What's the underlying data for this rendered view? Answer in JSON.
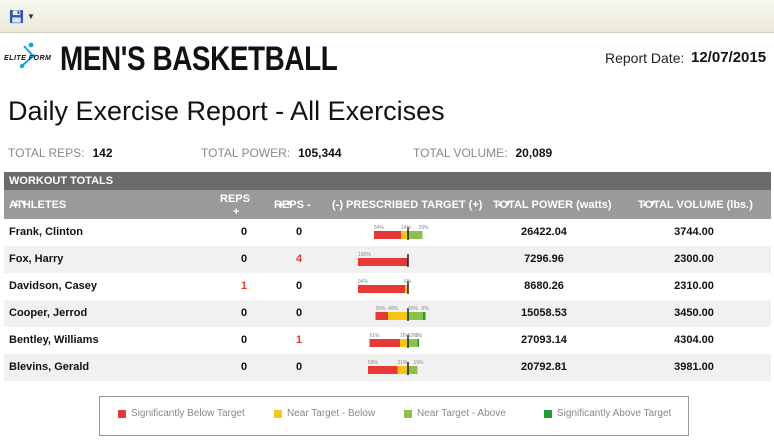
{
  "team_title": "MEN'S BASKETBALL",
  "logo": {
    "text": "ELITE FORM"
  },
  "report_date": {
    "label": "Report Date:",
    "value": "12/07/2015"
  },
  "report_title": "Daily Exercise Report - All Exercises",
  "totals": [
    {
      "label": "TOTAL REPS:",
      "value": "142"
    },
    {
      "label": "TOTAL POWER:",
      "value": "105,344"
    },
    {
      "label": "TOTAL VOLUME:",
      "value": "20,089"
    }
  ],
  "section_header": "WORKOUT TOTALS",
  "columns": {
    "athletes": "ATHLETES",
    "reps_plus_top": "REPS",
    "reps_plus_bottom": "+",
    "reps_minus": "REPS -",
    "target": "(-) PRESCRIBED TARGET (+)",
    "power": "TOTAL POWER (watts)",
    "volume": "TOTAL VOLUME (lbs.)"
  },
  "colors": {
    "significantly_below": "#e53935",
    "near_below": "#f5c518",
    "near_above": "#8bc34a",
    "significantly_above": "#1e9e3c"
  },
  "rows": [
    {
      "name": "Frank, Clinton",
      "reps_plus": "0",
      "reps_minus": "0",
      "power": "26422.04",
      "volume": "3744.00",
      "target": {
        "sig_below": 54,
        "near_below": 14,
        "near_above": 29,
        "sig_above": 0,
        "labels": [
          "54%",
          "14%",
          "29%"
        ]
      }
    },
    {
      "name": "Fox, Harry",
      "reps_plus": "0",
      "reps_minus": "4",
      "power": "7296.96",
      "volume": "2300.00",
      "target": {
        "sig_below": 100,
        "near_below": 0,
        "near_above": 0,
        "sig_above": 0,
        "labels": [
          "100%"
        ]
      }
    },
    {
      "name": "Davidson, Casey",
      "reps_plus": "1",
      "reps_minus": "0",
      "power": "8680.26",
      "volume": "2310.00",
      "target": {
        "sig_below": 94,
        "near_below": 6,
        "near_above": 0,
        "sig_above": 0,
        "labels": [
          "94%",
          "6%"
        ]
      }
    },
    {
      "name": "Cooper, Jerrod",
      "reps_plus": "0",
      "reps_minus": "0",
      "power": "15058.53",
      "volume": "3450.00",
      "target": {
        "sig_below": 25,
        "near_below": 40,
        "near_above": 30,
        "sig_above": 5,
        "labels": [
          "25%",
          "40%",
          "30%",
          "5%"
        ]
      }
    },
    {
      "name": "Bentley, Williams",
      "reps_plus": "0",
      "reps_minus": "1",
      "power": "27093.14",
      "volume": "4304.00",
      "target": {
        "sig_below": 61,
        "near_below": 16,
        "near_above": 19,
        "sig_above": 3,
        "labels": [
          "61%",
          "16%",
          "19%",
          "3%"
        ]
      }
    },
    {
      "name": "Blevins, Gerald",
      "reps_plus": "0",
      "reps_minus": "0",
      "power": "20792.81",
      "volume": "3981.00",
      "target": {
        "sig_below": 59,
        "near_below": 21,
        "near_above": 19,
        "sig_above": 0,
        "labels": [
          "59%",
          "21%",
          "19%"
        ]
      }
    }
  ],
  "legend": [
    {
      "label": "Significantly Below Target",
      "color": "#e53935"
    },
    {
      "label": "Near Target - Below",
      "color": "#f5c518"
    },
    {
      "label": "Near Target - Above",
      "color": "#8bc34a"
    },
    {
      "label": "Significantly Above Target",
      "color": "#1e9e3c"
    }
  ]
}
